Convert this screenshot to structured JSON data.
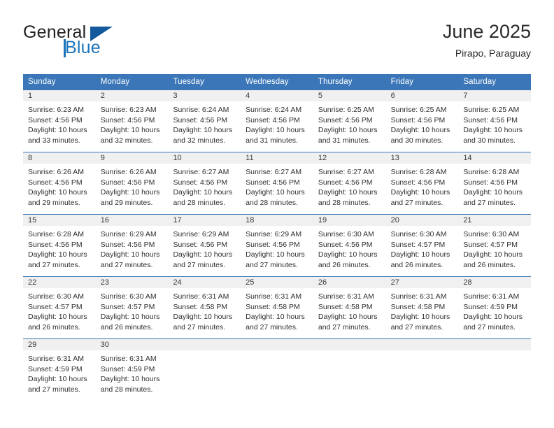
{
  "brand": {
    "name_part1": "General",
    "name_part2": "Blue",
    "logo_icon": "triangle-logo"
  },
  "header": {
    "title": "June 2025",
    "location": "Pirapo, Paraguay"
  },
  "calendar": {
    "day_headers": [
      "Sunday",
      "Monday",
      "Tuesday",
      "Wednesday",
      "Thursday",
      "Friday",
      "Saturday"
    ],
    "colors": {
      "header_blue": "#3b77b8",
      "day_band_gray": "#f0f0f0",
      "text": "#2f2f2f",
      "brand_blue": "#1b75bc"
    },
    "weeks": [
      [
        {
          "day": "1",
          "lines": [
            "Sunrise: 6:23 AM",
            "Sunset: 4:56 PM",
            "Daylight: 10 hours",
            "and 33 minutes."
          ]
        },
        {
          "day": "2",
          "lines": [
            "Sunrise: 6:23 AM",
            "Sunset: 4:56 PM",
            "Daylight: 10 hours",
            "and 32 minutes."
          ]
        },
        {
          "day": "3",
          "lines": [
            "Sunrise: 6:24 AM",
            "Sunset: 4:56 PM",
            "Daylight: 10 hours",
            "and 32 minutes."
          ]
        },
        {
          "day": "4",
          "lines": [
            "Sunrise: 6:24 AM",
            "Sunset: 4:56 PM",
            "Daylight: 10 hours",
            "and 31 minutes."
          ]
        },
        {
          "day": "5",
          "lines": [
            "Sunrise: 6:25 AM",
            "Sunset: 4:56 PM",
            "Daylight: 10 hours",
            "and 31 minutes."
          ]
        },
        {
          "day": "6",
          "lines": [
            "Sunrise: 6:25 AM",
            "Sunset: 4:56 PM",
            "Daylight: 10 hours",
            "and 30 minutes."
          ]
        },
        {
          "day": "7",
          "lines": [
            "Sunrise: 6:25 AM",
            "Sunset: 4:56 PM",
            "Daylight: 10 hours",
            "and 30 minutes."
          ]
        }
      ],
      [
        {
          "day": "8",
          "lines": [
            "Sunrise: 6:26 AM",
            "Sunset: 4:56 PM",
            "Daylight: 10 hours",
            "and 29 minutes."
          ]
        },
        {
          "day": "9",
          "lines": [
            "Sunrise: 6:26 AM",
            "Sunset: 4:56 PM",
            "Daylight: 10 hours",
            "and 29 minutes."
          ]
        },
        {
          "day": "10",
          "lines": [
            "Sunrise: 6:27 AM",
            "Sunset: 4:56 PM",
            "Daylight: 10 hours",
            "and 28 minutes."
          ]
        },
        {
          "day": "11",
          "lines": [
            "Sunrise: 6:27 AM",
            "Sunset: 4:56 PM",
            "Daylight: 10 hours",
            "and 28 minutes."
          ]
        },
        {
          "day": "12",
          "lines": [
            "Sunrise: 6:27 AM",
            "Sunset: 4:56 PM",
            "Daylight: 10 hours",
            "and 28 minutes."
          ]
        },
        {
          "day": "13",
          "lines": [
            "Sunrise: 6:28 AM",
            "Sunset: 4:56 PM",
            "Daylight: 10 hours",
            "and 27 minutes."
          ]
        },
        {
          "day": "14",
          "lines": [
            "Sunrise: 6:28 AM",
            "Sunset: 4:56 PM",
            "Daylight: 10 hours",
            "and 27 minutes."
          ]
        }
      ],
      [
        {
          "day": "15",
          "lines": [
            "Sunrise: 6:28 AM",
            "Sunset: 4:56 PM",
            "Daylight: 10 hours",
            "and 27 minutes."
          ]
        },
        {
          "day": "16",
          "lines": [
            "Sunrise: 6:29 AM",
            "Sunset: 4:56 PM",
            "Daylight: 10 hours",
            "and 27 minutes."
          ]
        },
        {
          "day": "17",
          "lines": [
            "Sunrise: 6:29 AM",
            "Sunset: 4:56 PM",
            "Daylight: 10 hours",
            "and 27 minutes."
          ]
        },
        {
          "day": "18",
          "lines": [
            "Sunrise: 6:29 AM",
            "Sunset: 4:56 PM",
            "Daylight: 10 hours",
            "and 27 minutes."
          ]
        },
        {
          "day": "19",
          "lines": [
            "Sunrise: 6:30 AM",
            "Sunset: 4:56 PM",
            "Daylight: 10 hours",
            "and 26 minutes."
          ]
        },
        {
          "day": "20",
          "lines": [
            "Sunrise: 6:30 AM",
            "Sunset: 4:57 PM",
            "Daylight: 10 hours",
            "and 26 minutes."
          ]
        },
        {
          "day": "21",
          "lines": [
            "Sunrise: 6:30 AM",
            "Sunset: 4:57 PM",
            "Daylight: 10 hours",
            "and 26 minutes."
          ]
        }
      ],
      [
        {
          "day": "22",
          "lines": [
            "Sunrise: 6:30 AM",
            "Sunset: 4:57 PM",
            "Daylight: 10 hours",
            "and 26 minutes."
          ]
        },
        {
          "day": "23",
          "lines": [
            "Sunrise: 6:30 AM",
            "Sunset: 4:57 PM",
            "Daylight: 10 hours",
            "and 26 minutes."
          ]
        },
        {
          "day": "24",
          "lines": [
            "Sunrise: 6:31 AM",
            "Sunset: 4:58 PM",
            "Daylight: 10 hours",
            "and 27 minutes."
          ]
        },
        {
          "day": "25",
          "lines": [
            "Sunrise: 6:31 AM",
            "Sunset: 4:58 PM",
            "Daylight: 10 hours",
            "and 27 minutes."
          ]
        },
        {
          "day": "26",
          "lines": [
            "Sunrise: 6:31 AM",
            "Sunset: 4:58 PM",
            "Daylight: 10 hours",
            "and 27 minutes."
          ]
        },
        {
          "day": "27",
          "lines": [
            "Sunrise: 6:31 AM",
            "Sunset: 4:58 PM",
            "Daylight: 10 hours",
            "and 27 minutes."
          ]
        },
        {
          "day": "28",
          "lines": [
            "Sunrise: 6:31 AM",
            "Sunset: 4:59 PM",
            "Daylight: 10 hours",
            "and 27 minutes."
          ]
        }
      ],
      [
        {
          "day": "29",
          "lines": [
            "Sunrise: 6:31 AM",
            "Sunset: 4:59 PM",
            "Daylight: 10 hours",
            "and 27 minutes."
          ]
        },
        {
          "day": "30",
          "lines": [
            "Sunrise: 6:31 AM",
            "Sunset: 4:59 PM",
            "Daylight: 10 hours",
            "and 28 minutes."
          ]
        },
        {
          "day": "",
          "lines": []
        },
        {
          "day": "",
          "lines": []
        },
        {
          "day": "",
          "lines": []
        },
        {
          "day": "",
          "lines": []
        },
        {
          "day": "",
          "lines": []
        }
      ]
    ]
  }
}
